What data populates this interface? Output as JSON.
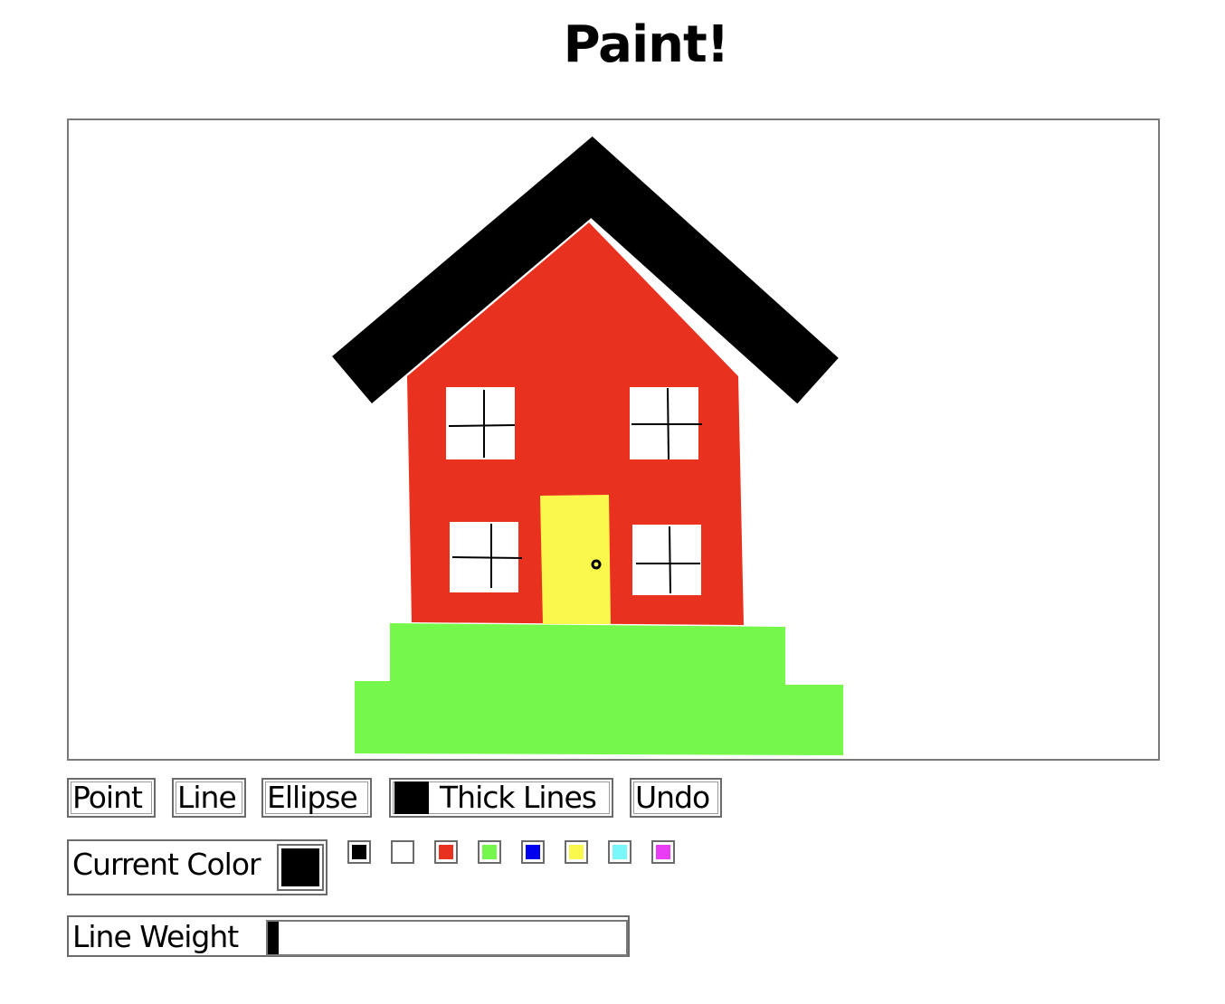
{
  "app": {
    "title": "Paint!"
  },
  "toolbar": {
    "point_label": "Point",
    "line_label": "Line",
    "ellipse_label": "Ellipse",
    "thick_lines_label": "Thick Lines",
    "undo_label": "Undo"
  },
  "color": {
    "label": "Current Color",
    "current": "#000000",
    "palette": [
      "#000000",
      "#ffffff",
      "#e8321f",
      "#76f74c",
      "#0000ee",
      "#fbf84d",
      "#78f8f8",
      "#e83cf5"
    ]
  },
  "line_weight": {
    "label": "Line Weight",
    "value": 0.03
  },
  "drawing": {
    "roof_color": "#000000",
    "wall_color": "#e8321f",
    "window_color": "#ffffff",
    "door_color": "#fbf84d",
    "grass_color": "#76f74c"
  }
}
